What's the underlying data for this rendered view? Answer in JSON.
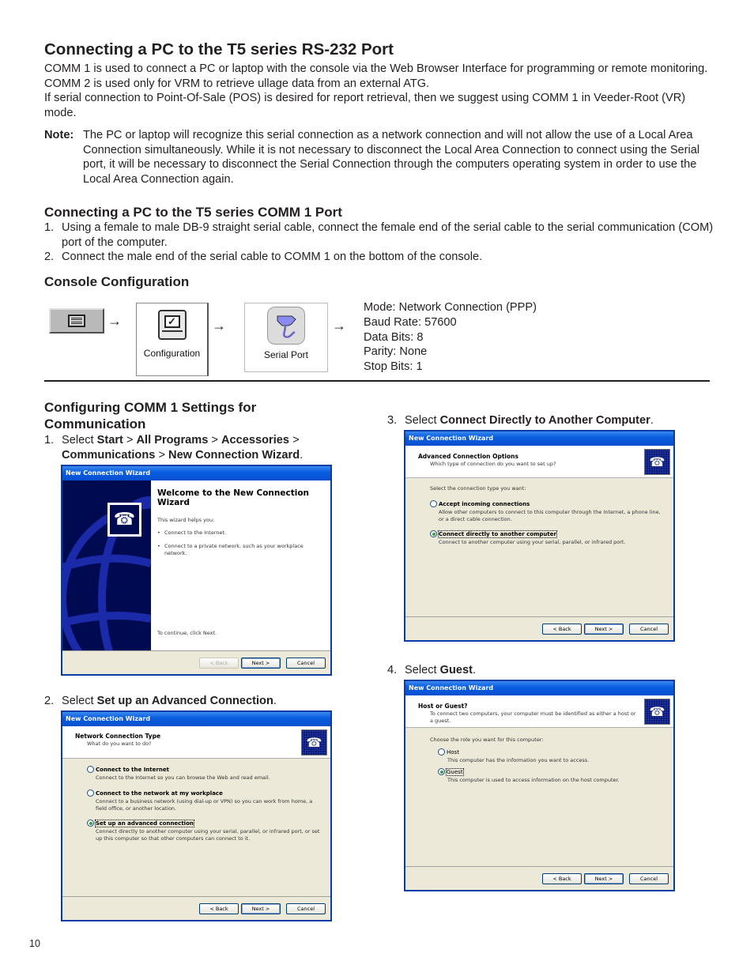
{
  "page": {
    "title": "Connecting a PC to the T5 series RS-232 Port",
    "intro": [
      "COMM 1 is used to connect a PC or laptop with the console via the Web Browser Interface for programming or remote monitoring. COMM 2 is used only for VRM to retrieve ullage data from an external ATG.",
      "If serial connection to Point-Of-Sale (POS) is desired for report retrieval, then we suggest using COMM 1 in Veeder-Root (VR) mode."
    ],
    "note": {
      "label": "Note:",
      "text": "The PC or laptop will recognize this serial connection as a network connection and will not allow the use of a Local Area Connection simultaneously. While it is not necessary to disconnect the Local Area Connection to connect using the Serial port, it will be necessary to disconnect the Serial Connection through the computers operating system in order to use the Local Area Connection again."
    },
    "page_number": "10"
  },
  "comm1": {
    "heading": "Connecting a PC to the T5 series COMM 1 Port",
    "steps": [
      {
        "num": "1.",
        "text": "Using a female to male DB-9 straight serial cable, connect the female end of the serial cable to the serial communication (COM) port of the computer."
      },
      {
        "num": "2.",
        "text": "Connect the male end of the serial cable to COMM 1 on the bottom of the console."
      }
    ]
  },
  "console": {
    "heading": "Console Configuration",
    "arrow": "→",
    "tiles": {
      "menu_icon": "menu-list-icon",
      "configuration_label": "Configuration",
      "configuration_icon": "configuration-icon",
      "serial_port_label": "Serial Port",
      "serial_port_icon": "serial-port-icon"
    },
    "settings": [
      "Mode: Network Connection (PPP)",
      "Baud Rate: 57600",
      "Data Bits: 8",
      "Parity: None",
      "Stop Bits: 1"
    ]
  },
  "configuring": {
    "heading": "Configuring COMM 1 Settings for Communication",
    "step1": {
      "num": "1.",
      "select": "Select ",
      "start": "Start",
      "sep": " > ",
      "all_programs": "All Programs",
      "accessories": "Accessories",
      "communications": "Communications",
      "wizard": "New Connection Wizard",
      "end": "."
    },
    "step2": {
      "num": "2.",
      "select": "Select ",
      "target": "Set up an Advanced Connection",
      "end": "."
    },
    "step3": {
      "num": "3.",
      "select": "Select ",
      "target": "Connect Directly to Another Computer",
      "end": "."
    },
    "step4": {
      "num": "4.",
      "select": "Select ",
      "target": "Guest",
      "end": "."
    }
  },
  "wizard": {
    "window_title": "New Connection Wizard",
    "buttons": {
      "back": "< Back",
      "next": "Next >",
      "cancel": "Cancel"
    },
    "welcome": {
      "title": "Welcome to the New Connection Wizard",
      "intro": "This wizard helps you:",
      "bullets": [
        "Connect to the Internet.",
        "Connect to a private network, such as your workplace network."
      ],
      "continue": "To continue, click Next."
    },
    "network_type": {
      "title": "Network Connection Type",
      "subtitle": "What do you want to do?",
      "options": [
        {
          "label": "Connect to the Internet",
          "desc": "Connect to the Internet so you can browse the Web and read email.",
          "selected": false
        },
        {
          "label": "Connect to the network at my workplace",
          "desc": "Connect to a business network (using dial-up or VPN) so you can work from home, a field office, or another location.",
          "selected": false
        },
        {
          "label": "Set up an advanced connection",
          "desc": "Connect directly to another computer using your serial, parallel, or infrared port, or set up this computer so that other computers can connect to it.",
          "selected": true
        }
      ]
    },
    "advanced": {
      "title": "Advanced Connection Options",
      "subtitle": "Which type of connection do you want to set up?",
      "prompt": "Select the connection type you want:",
      "options": [
        {
          "label": "Accept incoming connections",
          "desc": "Allow other computers to connect to this computer through the Internet, a phone line, or a direct cable connection.",
          "selected": false
        },
        {
          "label": "Connect directly to another computer",
          "desc": "Connect to another computer using your serial, parallel, or infrared port.",
          "selected": true
        }
      ]
    },
    "host_guest": {
      "title": "Host or Guest?",
      "subtitle": "To connect two computers, your computer must be identified as either a host or a guest.",
      "prompt": "Choose the role you want for this computer:",
      "options": [
        {
          "label": "Host",
          "desc": "This computer has the information you want to access.",
          "selected": false
        },
        {
          "label": "Guest",
          "desc": "This computer is used to access information on the host computer.",
          "selected": true
        }
      ]
    }
  }
}
